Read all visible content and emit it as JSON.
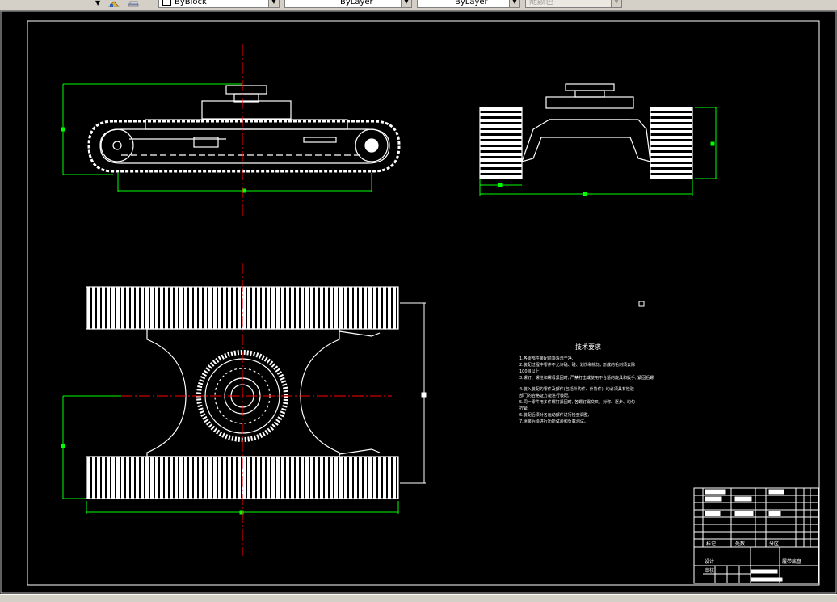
{
  "toolbar": {
    "block_combo": {
      "value": "ByBlock"
    },
    "linetype_combo": {
      "value": "ByLayer"
    },
    "lineweight_combo": {
      "value": "ByLayer"
    },
    "plotstyle_combo": {
      "value": "随颜色"
    }
  },
  "icons": {
    "layer_tool": "layer-tool-icon",
    "layer_stack": "layer-stack-icon"
  },
  "colors": {
    "cad_background": "#000000",
    "drawing_lines": "#ffffff",
    "dimension_green": "#00ff00",
    "centerline_red": "#ff0000",
    "ui_gray": "#d4d0c8"
  },
  "drawing": {
    "notes": {
      "heading": "技术要求",
      "lines": [
        "1.各零部件装配前须清洗干净,",
        "2.装配过程中零件不允许磕、碰、划伤和锈蚀, 形成的毛刺须去除",
        "100目以上,",
        "3.螺钉、螺栓和螺母紧固时, 严禁打击或使用不合适的旋具和扳手, 紧固后螺",
        "4.装入装配的零件及部件(包括外购件、外协件), 均必须具有检验",
        "部门的合格证方能进行装配,",
        "5.同一零件用多件螺钉紧固时, 各螺钉需交叉、对称、逐步、均匀",
        "拧紧,",
        "6.装配后须对各运动部件进行检查调整,",
        "7.组装后须进行功能试验和负载测试。"
      ]
    },
    "title_block": {
      "label_a": "标记",
      "label_b": "处数",
      "label_c": "分区",
      "drawing_name": "履带底盘",
      "sign_a": "设计",
      "sign_b": "审核"
    }
  }
}
